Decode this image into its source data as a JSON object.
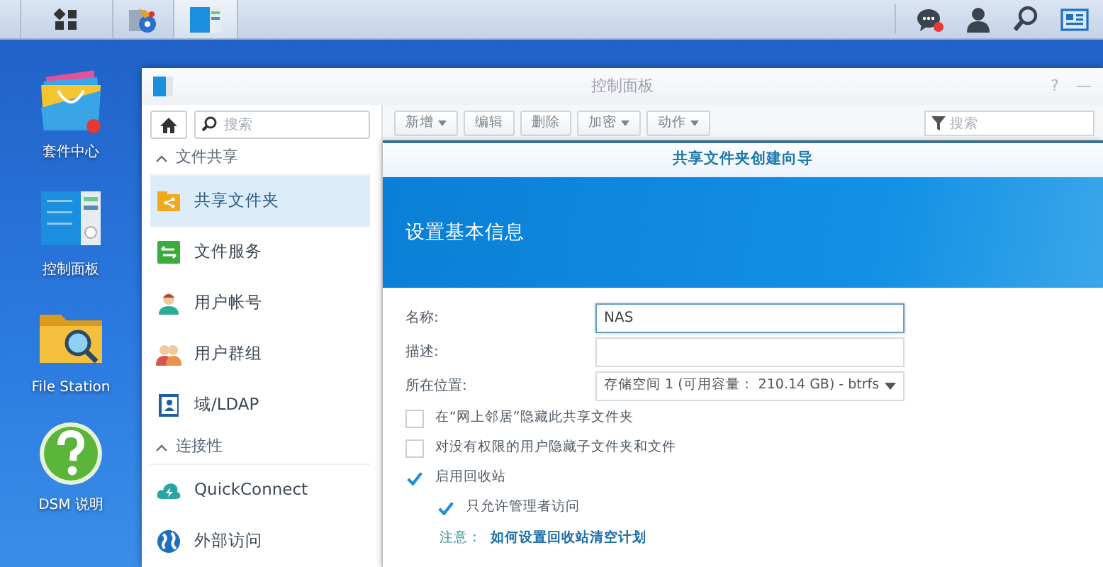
{
  "taskbar": {
    "apps": [
      {
        "kind": "main-menu",
        "selected": false
      },
      {
        "kind": "media",
        "selected": false
      },
      {
        "kind": "control-panel",
        "selected": true
      }
    ],
    "tray": [
      {
        "kind": "chat",
        "badge": true
      },
      {
        "kind": "user",
        "badge": false
      },
      {
        "kind": "search",
        "badge": false
      },
      {
        "kind": "widgets",
        "badge": false
      }
    ]
  },
  "desktop_icons": [
    {
      "kind": "package-center",
      "label": "套件中心"
    },
    {
      "kind": "control-panel",
      "label": "控制面板"
    },
    {
      "kind": "file-station",
      "label": "File Station"
    },
    {
      "kind": "help",
      "label": "DSM 说明"
    }
  ],
  "window": {
    "title": "控制面板",
    "controls": [
      "?",
      "—"
    ]
  },
  "sidebar": {
    "search": {
      "placeholder": "搜索"
    },
    "sections": [
      {
        "title": "文件共享",
        "expanded": true,
        "items": [
          {
            "kind": "shared-folder",
            "label": "共享文件夹",
            "selected": true
          },
          {
            "kind": "file-services",
            "label": "文件服务",
            "selected": false
          },
          {
            "kind": "user",
            "label": "用户帐号",
            "selected": false
          },
          {
            "kind": "group",
            "label": "用户群组",
            "selected": false
          },
          {
            "kind": "ldap",
            "label": "域/LDAP",
            "selected": false
          }
        ]
      },
      {
        "title": "连接性",
        "expanded": true,
        "items": [
          {
            "kind": "cloud",
            "label": "QuickConnect",
            "selected": false
          },
          {
            "kind": "globe",
            "label": "外部访问",
            "selected": false
          }
        ]
      }
    ]
  },
  "toolbar": {
    "buttons": [
      {
        "label": "新增",
        "dropdown": true
      },
      {
        "label": "编辑",
        "dropdown": false
      },
      {
        "label": "删除",
        "dropdown": false
      },
      {
        "label": "加密",
        "dropdown": true
      },
      {
        "label": "动作",
        "dropdown": true
      }
    ],
    "filter": {
      "placeholder": "搜索"
    }
  },
  "wizard": {
    "title": "共享文件夹创建向导",
    "heading": "设置基本信息",
    "fields": [
      {
        "kind": "text",
        "label": "名称:",
        "value": "NAS",
        "focused": true
      },
      {
        "kind": "text",
        "label": "描述:",
        "focused": false
      },
      {
        "kind": "select",
        "label": "所在位置:",
        "value": "存储空间 1 (可用容量： 210.14 GB) - btrfs",
        "focused": false
      }
    ],
    "options": [
      {
        "label": "在“网上邻居”隐藏此共享文件夹",
        "checked": false
      },
      {
        "label": "对没有权限的用户隐藏子文件夹和文件",
        "checked": false
      },
      {
        "label": "启用回收站",
        "checked": true,
        "children": [
          {
            "label": "只允许管理者访问",
            "checked": true
          }
        ]
      }
    ],
    "note": {
      "label": "注意：",
      "link": "如何设置回收站清空计划"
    }
  }
}
